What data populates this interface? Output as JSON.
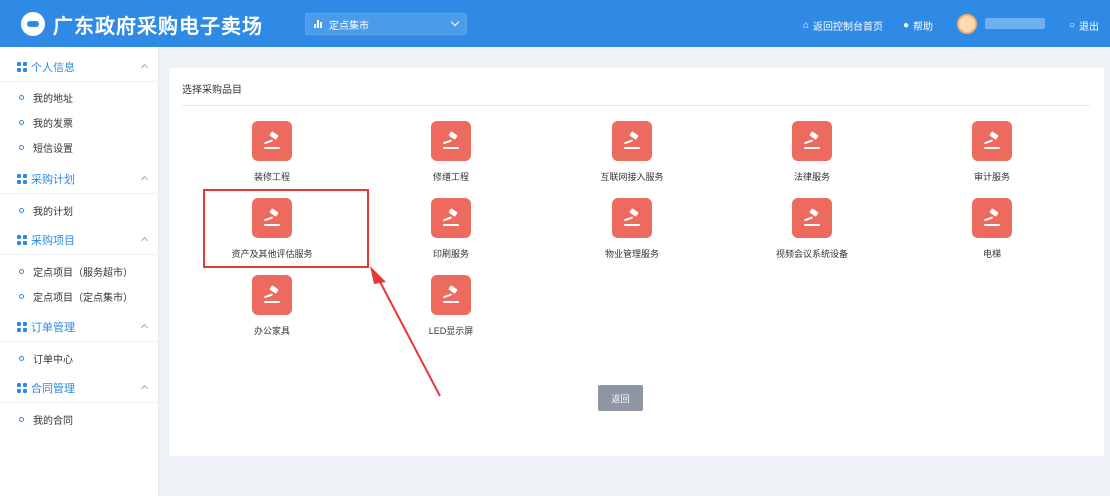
{
  "header": {
    "brand_title": "广东政府采购电子卖场",
    "market_select": "定点集市",
    "back_console": "返回控制台首页",
    "help": "帮助",
    "logout": "退出"
  },
  "sidebar": {
    "groups": [
      {
        "label": "个人信息",
        "items": [
          "我的地址",
          "我的发票",
          "短信设置"
        ]
      },
      {
        "label": "采购计划",
        "items": [
          "我的计划"
        ]
      },
      {
        "label": "采购项目",
        "items": [
          "定点项目（服务超市）",
          "定点项目（定点集市）"
        ]
      },
      {
        "label": "订单管理",
        "items": [
          "订单中心"
        ]
      },
      {
        "label": "合同管理",
        "items": [
          "我的合同"
        ]
      }
    ]
  },
  "main": {
    "title": "选择采购品目",
    "categories": [
      "装修工程",
      "修缮工程",
      "互联网接入服务",
      "法律服务",
      "审计服务",
      "资产及其他评估服务",
      "印刷服务",
      "物业管理服务",
      "视频会议系统设备",
      "电梯",
      "办公家具",
      "LED显示屏"
    ],
    "back_button": "返回"
  },
  "annotation": {
    "highlight_color": "#e53935",
    "highlighted_category": "资产及其他评估服务"
  },
  "colors": {
    "brand": "#2f8ae5",
    "tile": "#ec6a5e"
  }
}
